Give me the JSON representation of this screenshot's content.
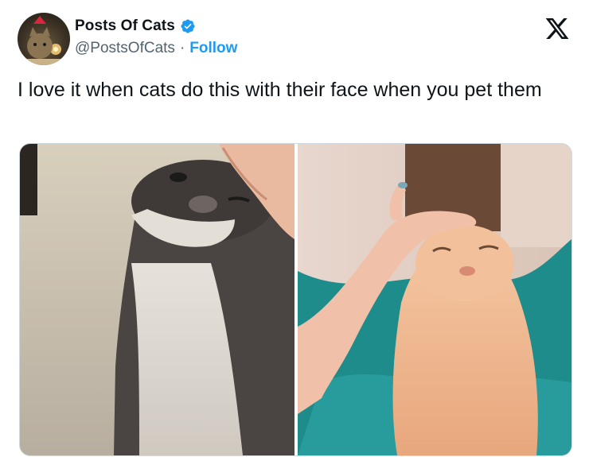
{
  "author": {
    "display_name": "Posts Of Cats",
    "handle": "@PostsOfCats",
    "separator": "·",
    "follow_label": "Follow",
    "verified": true,
    "avatar_icon": "cat-avatar"
  },
  "tweet": {
    "text": "I love it when cats do this with their face when you pet them"
  },
  "media": {
    "photos": [
      {
        "subject": "grey-and-white cat being petted, eyes squinting"
      },
      {
        "subject": "orange tabby cat being petted on a bed"
      }
    ]
  },
  "icons": {
    "verified": "verified-badge-icon",
    "platform": "x-logo-icon"
  },
  "colors": {
    "link": "#1d9bf0",
    "verified": "#1d9bf0",
    "secondary_text": "#536471",
    "primary_text": "#0f1419"
  }
}
